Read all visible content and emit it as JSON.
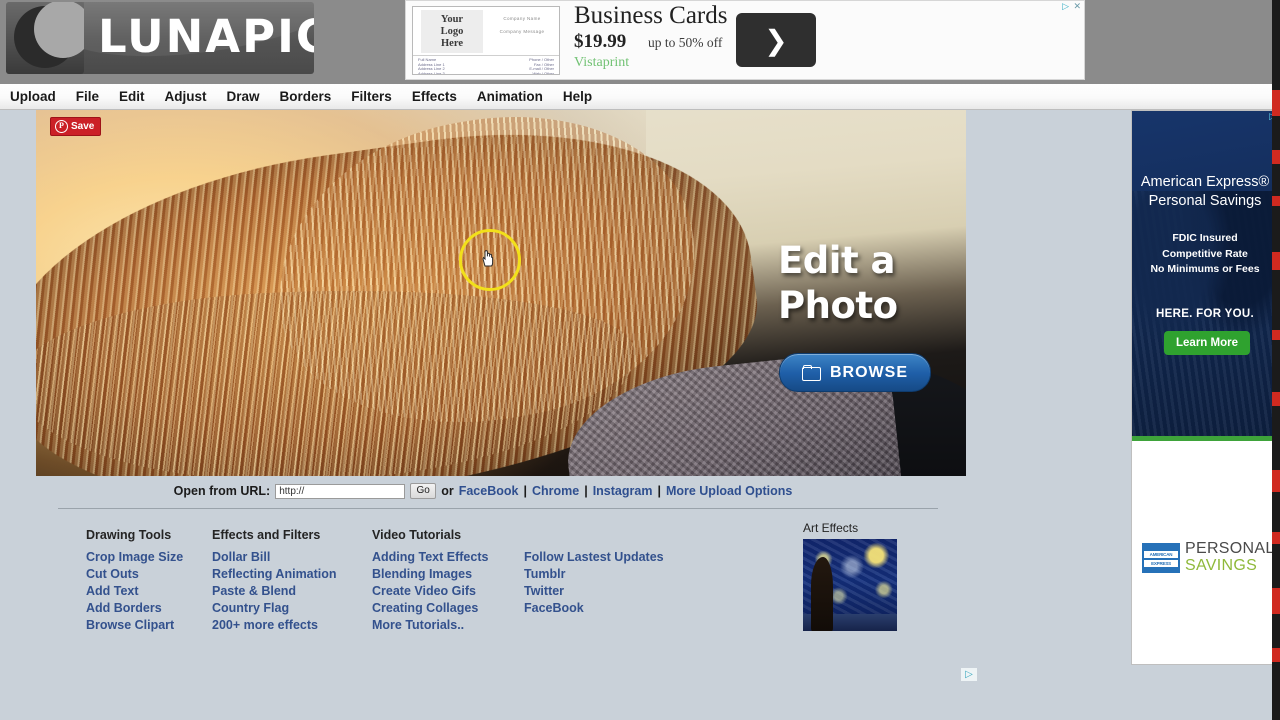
{
  "site": {
    "logo_text": "LUNAPIC",
    "logo_icon": "moon-icon"
  },
  "top_ad": {
    "card_logo_line1": "Your",
    "card_logo_line2": "Logo",
    "card_logo_line3": "Here",
    "card_company_name": "Company Name",
    "card_company_message": "Company Message",
    "card_rows": [
      {
        "left": "Full Name",
        "right": "Phone / Other"
      },
      {
        "left": "Address Line 1",
        "right": "Fax / Other"
      },
      {
        "left": "Address Line 2",
        "right": "E-mail / Other"
      },
      {
        "left": "Address Line 3",
        "right": "Web / Other"
      }
    ],
    "title": "Business Cards",
    "price": "$19.99",
    "offer": "up to 50% off",
    "brand": "Vistaprint",
    "cta_glyph": "❯",
    "adchoices_glyph": "▷",
    "close_glyph": "✕"
  },
  "menu": {
    "items": [
      {
        "label": "Upload"
      },
      {
        "label": "File"
      },
      {
        "label": "Edit"
      },
      {
        "label": "Adjust"
      },
      {
        "label": "Draw"
      },
      {
        "label": "Borders"
      },
      {
        "label": "Filters"
      },
      {
        "label": "Effects"
      },
      {
        "label": "Animation"
      },
      {
        "label": "Help"
      }
    ]
  },
  "hero": {
    "pinterest_label": "Save",
    "pinterest_glyph": "P",
    "headline_line1": "Edit a",
    "headline_line2": "Photo",
    "browse_label": "BROWSE",
    "browse_icon": "folder-icon",
    "cursor_highlight_color": "#f2e01a"
  },
  "url_row": {
    "label": "Open from URL:",
    "input_value": "http://",
    "input_placeholder": "http://",
    "go_label": "Go",
    "or_label": "or",
    "links": [
      "FaceBook",
      "Chrome",
      "Instagram",
      "More Upload Options"
    ],
    "separator": "|"
  },
  "columns": [
    {
      "heading": "Drawing Tools",
      "links": [
        "Crop Image Size",
        "Cut Outs",
        "Add Text",
        "Add Borders",
        "Browse Clipart"
      ]
    },
    {
      "heading": "Effects and Filters",
      "links": [
        "Dollar Bill",
        "Reflecting Animation",
        "Paste & Blend",
        "Country Flag",
        "200+ more effects"
      ]
    },
    {
      "heading": "Video Tutorials",
      "links": [
        "Adding Text Effects",
        "Blending Images",
        "Create Video Gifs",
        "Creating Collages",
        "More Tutorials.."
      ]
    },
    {
      "heading": "",
      "links": [
        "Follow Lastest Updates",
        "Tumblr",
        "Twitter",
        "FaceBook"
      ]
    }
  ],
  "art_effects": {
    "heading": "Art Effects",
    "thumbnail_alt": "starry-night-thumbnail"
  },
  "side_ad": {
    "title_line1": "American Express®",
    "title_line2": "Personal Savings",
    "bullet1": "FDIC Insured",
    "bullet2": "Competitive Rate",
    "bullet3": "No Minimums or Fees",
    "tagline": "HERE. FOR YOU.",
    "cta_label": "Learn More",
    "cta_color": "#2fa22f",
    "logo_line1": "AMERICAN",
    "logo_line2": "EXPRESS",
    "logo_text1": "PERSONAL",
    "logo_text2": "SAVINGS",
    "adchoices_glyph": "▷"
  },
  "bottom_ad": {
    "adchoices_glyph": "▷"
  },
  "video_strip": {
    "marker_color": "#d02a20"
  }
}
